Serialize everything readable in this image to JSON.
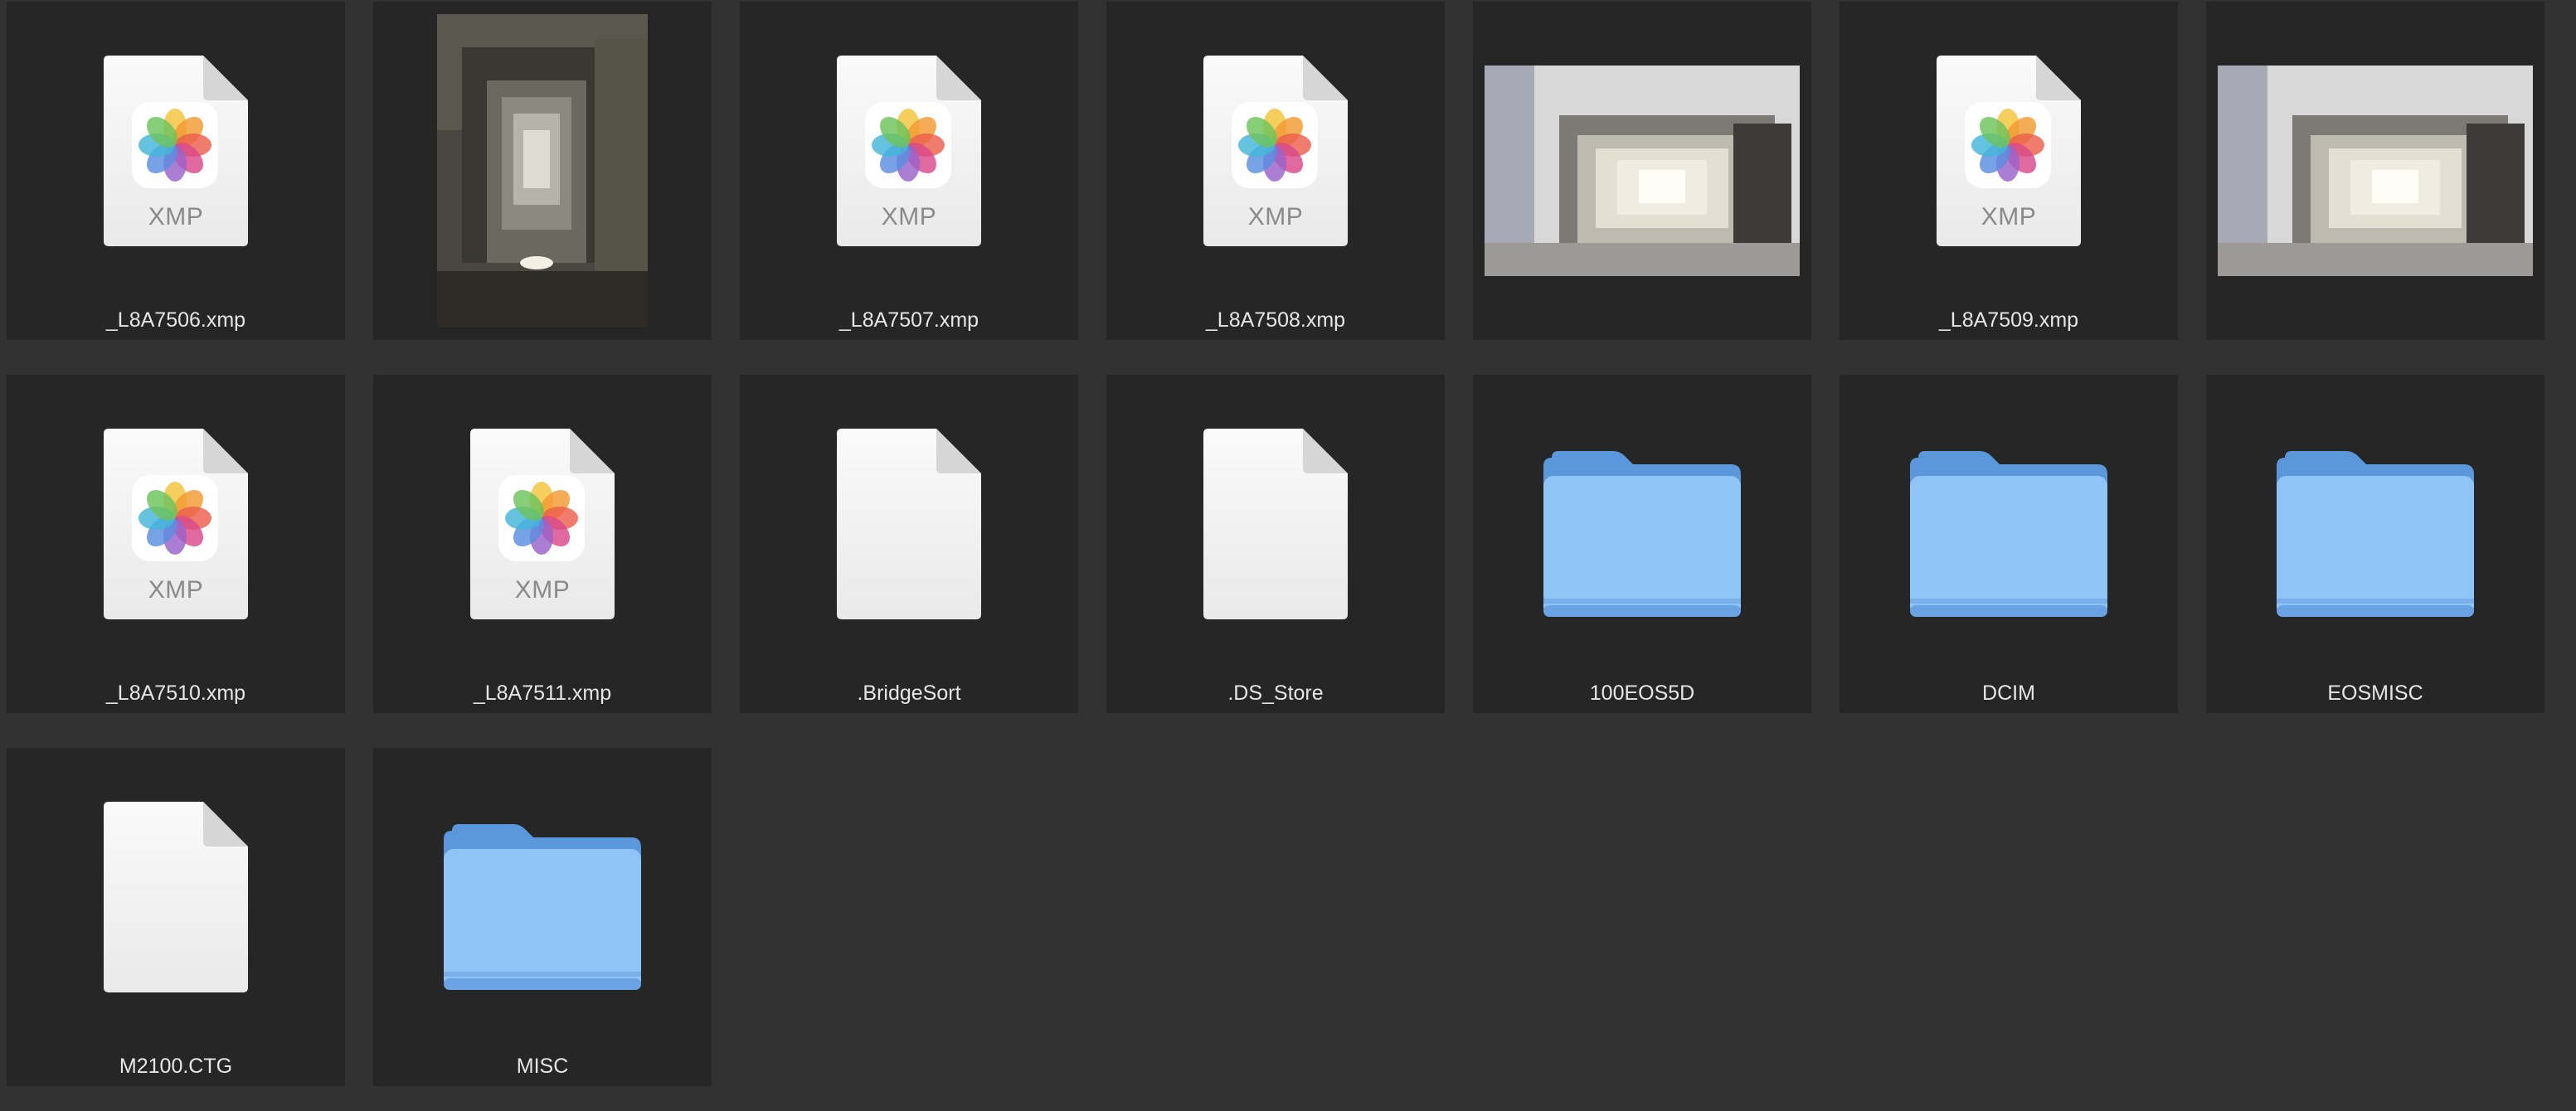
{
  "items": [
    {
      "kind": "xmp",
      "name": "_L8A7506.xmp",
      "badge": "XMP"
    },
    {
      "kind": "photo-portrait",
      "name": ""
    },
    {
      "kind": "xmp",
      "name": "_L8A7507.xmp",
      "badge": "XMP"
    },
    {
      "kind": "xmp",
      "name": "_L8A7508.xmp",
      "badge": "XMP"
    },
    {
      "kind": "photo-landscape",
      "name": ""
    },
    {
      "kind": "xmp",
      "name": "_L8A7509.xmp",
      "badge": "XMP"
    },
    {
      "kind": "photo-landscape",
      "name": ""
    },
    {
      "kind": "xmp",
      "name": "_L8A7510.xmp",
      "badge": "XMP"
    },
    {
      "kind": "xmp",
      "name": "_L8A7511.xmp",
      "badge": "XMP"
    },
    {
      "kind": "blank-doc",
      "name": ".BridgeSort"
    },
    {
      "kind": "blank-doc",
      "name": ".DS_Store"
    },
    {
      "kind": "folder",
      "name": "100EOS5D"
    },
    {
      "kind": "folder",
      "name": "DCIM"
    },
    {
      "kind": "folder",
      "name": "EOSMISC"
    },
    {
      "kind": "blank-doc",
      "name": "M2100.CTG"
    },
    {
      "kind": "folder",
      "name": "MISC"
    }
  ],
  "colors": {
    "window_bg": "#323232",
    "tile_bg": "#262626",
    "caption": "#e6e6e6",
    "folder_front": "#8fc4f7",
    "folder_back": "#5b97db"
  }
}
